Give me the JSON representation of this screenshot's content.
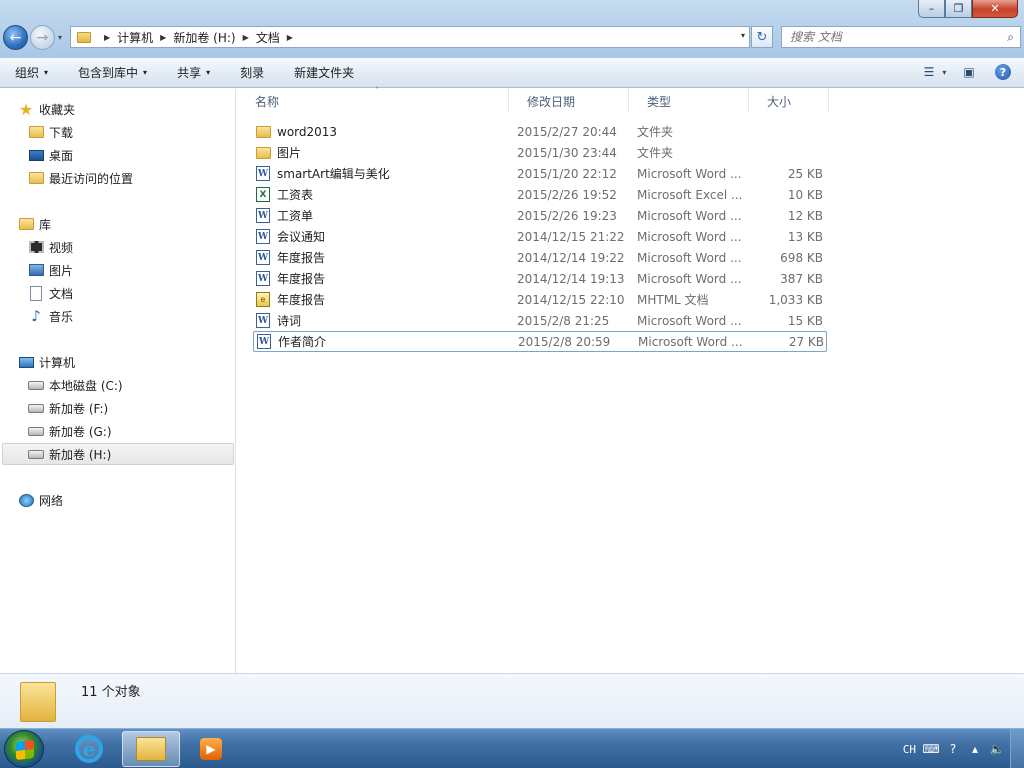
{
  "window": {
    "minimize_glyph": "–",
    "maximize_glyph": "❐",
    "close_glyph": "✕"
  },
  "nav": {
    "back_glyph": "←",
    "forward_glyph": "→",
    "history_glyph": "▾"
  },
  "address": {
    "crumbs": [
      "计算机",
      "新加卷 (H:)",
      "文档"
    ],
    "separator": "▶",
    "dropdown_glyph": "▾",
    "refresh_glyph": "↻"
  },
  "search": {
    "placeholder": "搜索 文档",
    "icon_glyph": "⌕"
  },
  "toolbar": {
    "organize": "组织",
    "include_in_library": "包含到库中",
    "share": "共享",
    "burn": "刻录",
    "new_folder": "新建文件夹",
    "caret": "▾",
    "view_glyph": "☰",
    "preview_glyph": "▣",
    "help_glyph": "?"
  },
  "sidebar": {
    "favorites": "收藏夹",
    "downloads": "下载",
    "desktop": "桌面",
    "recent_places": "最近访问的位置",
    "libraries": "库",
    "videos": "视频",
    "pictures": "图片",
    "documents": "文档",
    "music": "音乐",
    "computer": "计算机",
    "drive_c": "本地磁盘 (C:)",
    "drive_f": "新加卷 (F:)",
    "drive_g": "新加卷 (G:)",
    "drive_h": "新加卷 (H:)",
    "network": "网络",
    "star_glyph": "★",
    "music_glyph": "♪"
  },
  "columns": {
    "name": "名称",
    "date_modified": "修改日期",
    "type": "类型",
    "size": "大小",
    "sort_glyph": "˄"
  },
  "files": [
    {
      "name": "word2013",
      "date": "2015/2/27 20:44",
      "type": "文件夹",
      "size": "",
      "icon": "folder"
    },
    {
      "name": "图片",
      "date": "2015/1/30 23:44",
      "type": "文件夹",
      "size": "",
      "icon": "folder"
    },
    {
      "name": "smartArt编辑与美化",
      "date": "2015/1/20 22:12",
      "type": "Microsoft Word ...",
      "size": "25 KB",
      "icon": "word"
    },
    {
      "name": "工资表",
      "date": "2015/2/26 19:52",
      "type": "Microsoft Excel ...",
      "size": "10 KB",
      "icon": "excel"
    },
    {
      "name": "工资单",
      "date": "2015/2/26 19:23",
      "type": "Microsoft Word ...",
      "size": "12 KB",
      "icon": "word"
    },
    {
      "name": "会议通知",
      "date": "2014/12/15 21:22",
      "type": "Microsoft Word ...",
      "size": "13 KB",
      "icon": "word"
    },
    {
      "name": "年度报告",
      "date": "2014/12/14 19:22",
      "type": "Microsoft Word ...",
      "size": "698 KB",
      "icon": "word"
    },
    {
      "name": "年度报告",
      "date": "2014/12/14 19:13",
      "type": "Microsoft Word ...",
      "size": "387 KB",
      "icon": "word"
    },
    {
      "name": "年度报告",
      "date": "2014/12/15 22:10",
      "type": "MHTML 文档",
      "size": "1,033 KB",
      "icon": "mhtml"
    },
    {
      "name": "诗词",
      "date": "2015/2/8 21:25",
      "type": "Microsoft Word ...",
      "size": "15 KB",
      "icon": "word"
    },
    {
      "name": "作者简介",
      "date": "2015/2/8 20:59",
      "type": "Microsoft Word ...",
      "size": "27 KB",
      "icon": "word"
    }
  ],
  "icon_glyphs": {
    "word": "W",
    "excel": "X",
    "mhtml": "e"
  },
  "details": {
    "count": "11 个对象"
  },
  "taskbar": {
    "ie_glyph": "e",
    "wmp_glyph": "▶",
    "lang": "CH",
    "keyboard_glyph": "⌨",
    "help_glyph": "?",
    "tray_up_glyph": "▴",
    "volume_glyph": "🔈"
  }
}
